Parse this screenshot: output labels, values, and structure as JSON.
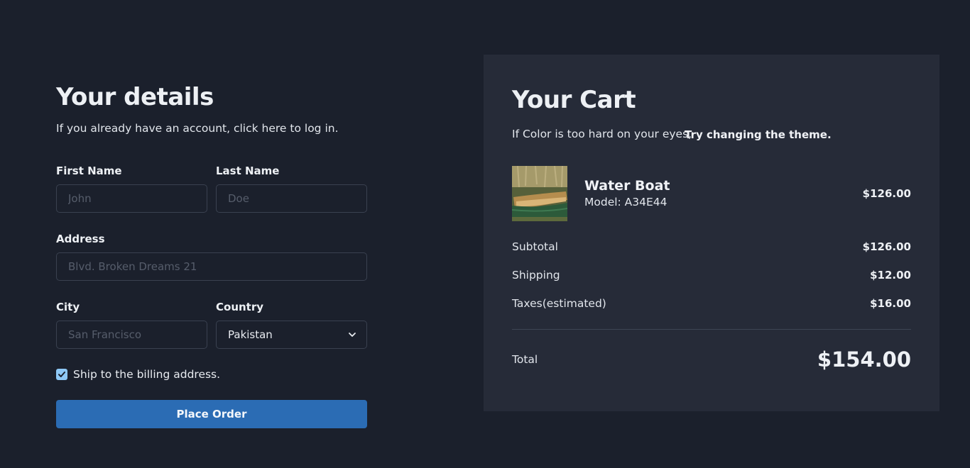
{
  "details": {
    "title": "Your details",
    "subtitle": "If you already have an account, click here to log in.",
    "first_name": {
      "label": "First Name",
      "placeholder": "John",
      "value": ""
    },
    "last_name": {
      "label": "Last Name",
      "placeholder": "Doe",
      "value": ""
    },
    "address": {
      "label": "Address",
      "placeholder": "Blvd. Broken Dreams 21",
      "value": ""
    },
    "city": {
      "label": "City",
      "placeholder": "San Francisco",
      "value": ""
    },
    "country": {
      "label": "Country",
      "selected": "Pakistan",
      "icon": "chevron-down-icon"
    },
    "ship_checkbox": {
      "label": "Ship to the billing address.",
      "checked": true,
      "icon": "checkmark-icon"
    },
    "place_order_label": "Place Order"
  },
  "cart": {
    "title": "Your Cart",
    "hint": "If Color is too hard on your eyes,",
    "theme_link": "Try changing the theme.",
    "item": {
      "name": "Water Boat",
      "model": "Model: A34E44",
      "price": "$126.00",
      "image": "boat-thumbnail"
    },
    "summary": {
      "subtotal_label": "Subtotal",
      "subtotal_value": "$126.00",
      "shipping_label": "Shipping",
      "shipping_value": "$12.00",
      "taxes_label": "Taxes(estimated)",
      "taxes_value": "$16.00"
    },
    "total_label": "Total",
    "total_value": "$154.00"
  },
  "colors": {
    "background": "#1b202c",
    "panel": "#262b38",
    "accent_button": "#2b6cb4",
    "checkbox": "#8ec8f6"
  }
}
